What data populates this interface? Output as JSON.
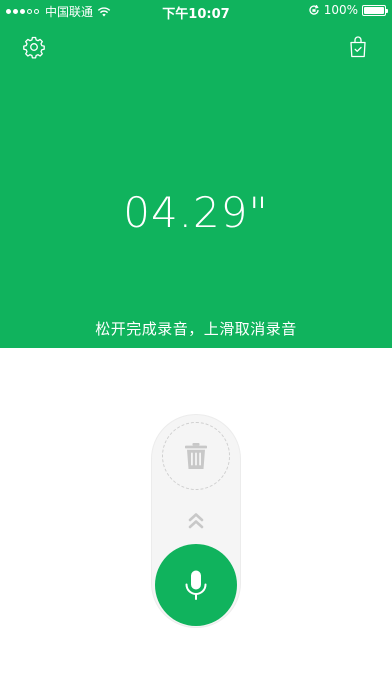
{
  "status_bar": {
    "carrier": "中国联通",
    "time": "下午10:07",
    "battery_text": "100%",
    "battery_level": 1.0
  },
  "header": {
    "settings_icon": "gear-icon",
    "bag_icon": "shopping-bag-check-icon"
  },
  "recorder": {
    "elapsed": "04.29\"",
    "hint": "松开完成录音，上滑取消录音"
  },
  "controls": {
    "delete_icon": "trash-icon",
    "swipe_icon": "double-chevron-up-icon",
    "record_icon": "microphone-icon"
  },
  "colors": {
    "accent": "#10b35d",
    "background": "#ffffff",
    "track": "#f5f5f5",
    "muted_icon": "#c8c8c8"
  }
}
